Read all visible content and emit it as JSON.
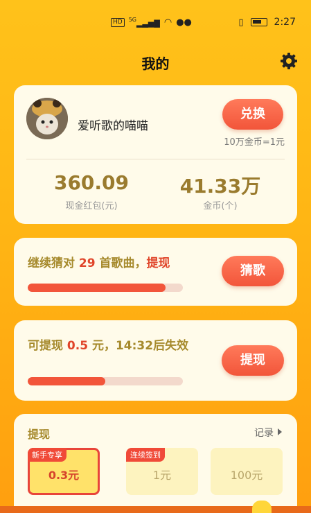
{
  "status_bar": {
    "network_badge": "HD",
    "signal_badge": "5G",
    "time": "2:27"
  },
  "header": {
    "title": "我的",
    "settings_icon": "gear-icon"
  },
  "profile": {
    "username": "爱听歌的喵喵",
    "exchange_label": "兑换",
    "rate": "10万金币=1元",
    "cash_value": "360.09",
    "cash_label": "现金红包(元)",
    "coins_value": "41.33万",
    "coins_label": "金币(个)"
  },
  "task_guess": {
    "prefix": "继续猜对 ",
    "count": "29",
    "middle": " 首歌曲，",
    "action": "提现",
    "progress": 0.89,
    "button_label": "猜歌"
  },
  "task_withdraw": {
    "prefix": "可提现 ",
    "amount": "0.5",
    "suffix": " 元，14:32后失效",
    "progress": 0.5,
    "button_label": "提现"
  },
  "withdraw": {
    "title": "提现",
    "record_label": "记录",
    "options": [
      {
        "tag": "新手专享",
        "amount": "0.3元",
        "selected": true
      },
      {
        "tag": "连续签到",
        "amount": "1元",
        "selected": false
      },
      {
        "tag": "",
        "amount": "100元",
        "selected": false
      }
    ]
  },
  "colors": {
    "accent": "#f2553a",
    "background": "#ffc21a",
    "card": "#fffbea",
    "gold_text": "#9a7b2e"
  }
}
